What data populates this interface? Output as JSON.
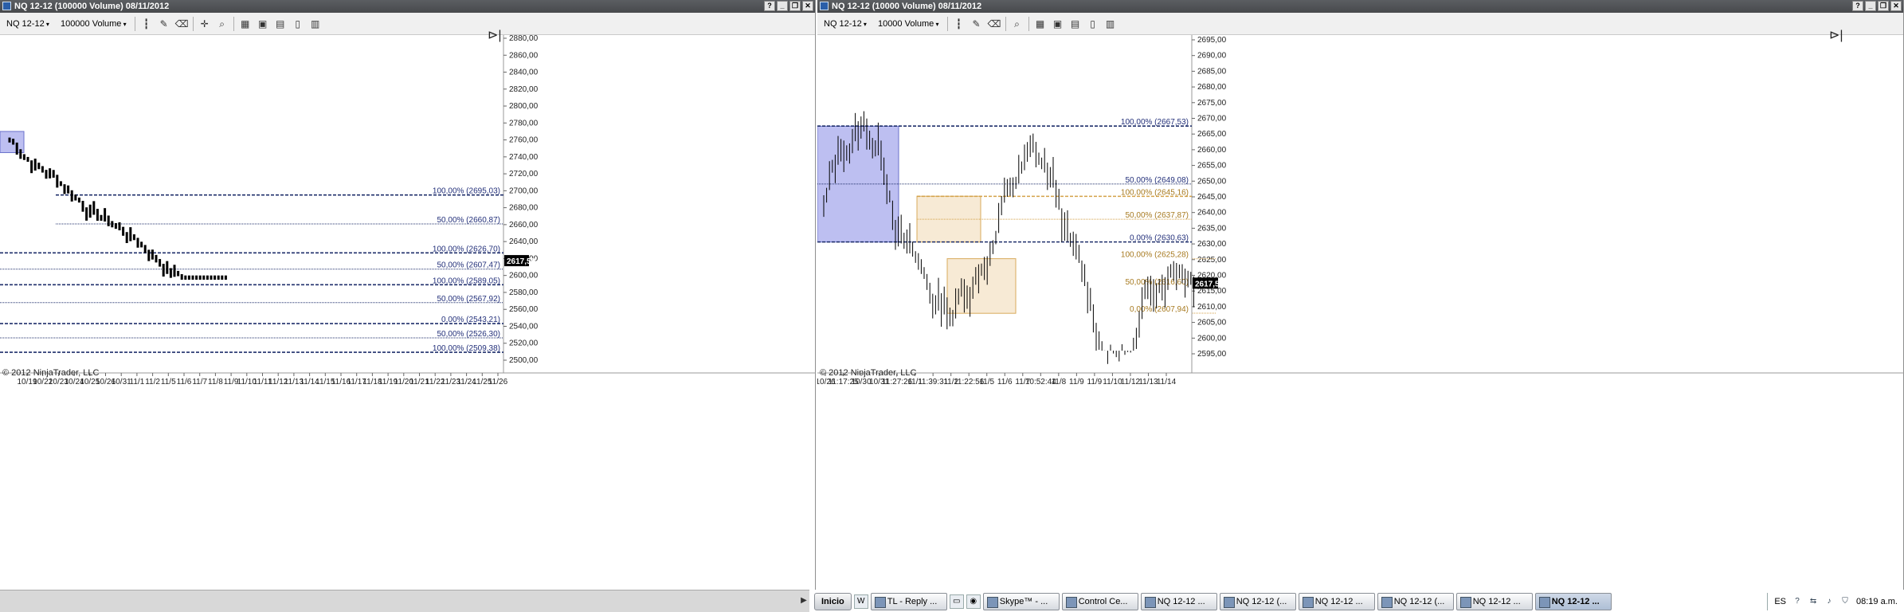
{
  "colors": {
    "navy": "#1f2f6b",
    "orange": "#d4a24a",
    "fib_text": "#23307a",
    "orange_text": "#a77a20",
    "price_tag": "#000000",
    "box_blue": "#b6b9f0",
    "box_orange": "#f7e8d1"
  },
  "left": {
    "title": "NQ 12-12 (100000 Volume)  08/11/2012",
    "instrument": "NQ 12-12",
    "period": "100000 Volume",
    "copyright": "© 2012 NinjaTrader, LLC",
    "price_tag": "2617,50",
    "y_ticks": [
      "2880,00",
      "2860,00",
      "2840,00",
      "2820,00",
      "2800,00",
      "2780,00",
      "2760,00",
      "2740,00",
      "2720,00",
      "2700,00",
      "2680,00",
      "2660,00",
      "2640,00",
      "2620,00",
      "2600,00",
      "2580,00",
      "2560,00",
      "2540,00",
      "2520,00",
      "2500,00"
    ],
    "x_ticks": [
      "10/19",
      "10/22",
      "10/23",
      "10/24",
      "10/25",
      "10/26",
      "10/31",
      "11/1",
      "11/2",
      "11/5",
      "11/6",
      "11/7",
      "11/8",
      "11/9",
      "11/10",
      "11/11",
      "11/12",
      "11/13",
      "11/14",
      "11/15",
      "11/16",
      "11/17",
      "11/18",
      "11/19",
      "11/20",
      "11/21",
      "11/22",
      "11/23",
      "11/24",
      "11/25",
      "11/26"
    ],
    "fib_labels": [
      {
        "text": "100,00% (2695,03)",
        "style": "navy"
      },
      {
        "text": "50,00% (2660,87)",
        "style": "navy"
      },
      {
        "text": "100,00% (2626,70)",
        "style": "navy"
      },
      {
        "text": "50,00% (2607,47)",
        "style": "navy"
      },
      {
        "text": "100,00% (2589,05)",
        "style": "navy"
      },
      {
        "text": "50,00% (2567,92)",
        "style": "navy"
      },
      {
        "text": "0,00% (2543,21)",
        "style": "navy"
      },
      {
        "text": "50,00% (2526,30)",
        "style": "navy"
      },
      {
        "text": "100,00% (2509,38)",
        "style": "navy"
      }
    ]
  },
  "right": {
    "title": "NQ 12-12 (10000 Volume)  08/11/2012",
    "instrument": "NQ 12-12",
    "period": "10000 Volume",
    "copyright": "© 2012 NinjaTrader, LLC",
    "price_tag": "2617,50",
    "y_ticks": [
      "2695,00",
      "2690,00",
      "2685,00",
      "2680,00",
      "2675,00",
      "2670,00",
      "2665,00",
      "2660,00",
      "2655,00",
      "2650,00",
      "2645,00",
      "2640,00",
      "2635,00",
      "2630,00",
      "2625,00",
      "2620,00",
      "2615,00",
      "2610,00",
      "2605,00",
      "2600,00",
      "2595,00"
    ],
    "x_ticks": [
      "10/26",
      "11:17:25",
      "10/30",
      "10/31",
      "11:27:26",
      "11/1",
      "11:39:31",
      "11/2",
      "11:22:56",
      "11/5",
      "11/6",
      "11/7",
      "10:52:44",
      "11/8",
      "11/9",
      "11/9",
      "11/10",
      "11/12",
      "11/13",
      "11/14"
    ],
    "fib_labels": [
      {
        "text": "100,00% (2667,53)",
        "style": "navy"
      },
      {
        "text": "50,00% (2649,08)",
        "style": "navy"
      },
      {
        "text": "100,00% (2645,16)",
        "style": "orange"
      },
      {
        "text": "50,00% (2637,87)",
        "style": "orange"
      },
      {
        "text": "0,00% (2630,63)",
        "style": "navy"
      },
      {
        "text": "100,00% (2625,28)",
        "style": "orange"
      },
      {
        "text": "50,00% (2616,60)",
        "style": "orange"
      },
      {
        "text": "0,00% (2607,94)",
        "style": "orange"
      }
    ]
  },
  "taskbar": {
    "start": "Inicio",
    "tasks": [
      "TL - Reply ...",
      "Skype™ - ...",
      "Control Ce...",
      "NQ 12-12 ...",
      "NQ 12-12 (...",
      "NQ 12-12 ...",
      "NQ 12-12 (...",
      "NQ 12-12 ...",
      "NQ 12-12 ..."
    ],
    "lang": "ES",
    "clock": "08:19 a.m."
  }
}
